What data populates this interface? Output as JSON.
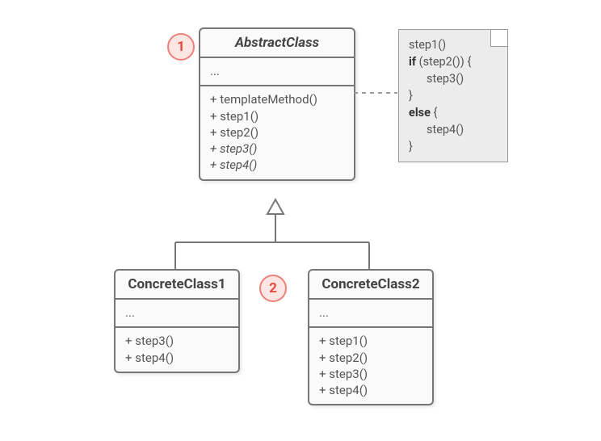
{
  "abstractClass": {
    "title": "AbstractClass",
    "attrs": "...",
    "methods": [
      {
        "text": "+ templateMethod()",
        "italic": false
      },
      {
        "text": "+ step1()",
        "italic": false
      },
      {
        "text": "+ step2()",
        "italic": false
      },
      {
        "text": "+ step3()",
        "italic": true
      },
      {
        "text": "+ step4()",
        "italic": true
      }
    ]
  },
  "concrete1": {
    "title": "ConcreteClass1",
    "attrs": "...",
    "methods": [
      {
        "text": "+ step3()"
      },
      {
        "text": "+ step4()"
      }
    ]
  },
  "concrete2": {
    "title": "ConcreteClass2",
    "attrs": "...",
    "methods": [
      {
        "text": "+ step1()"
      },
      {
        "text": "+ step2()"
      },
      {
        "text": "+ step3()"
      },
      {
        "text": "+ step4()"
      }
    ]
  },
  "badges": {
    "one": "1",
    "two": "2"
  },
  "note": {
    "l1_a": "step1()",
    "l2_kw": "if",
    "l2_rest": " (step2()) {",
    "l3": "step3()",
    "l4": "}",
    "l5_kw": "else",
    "l5_rest": " {",
    "l6": "step4()",
    "l7": "}"
  }
}
